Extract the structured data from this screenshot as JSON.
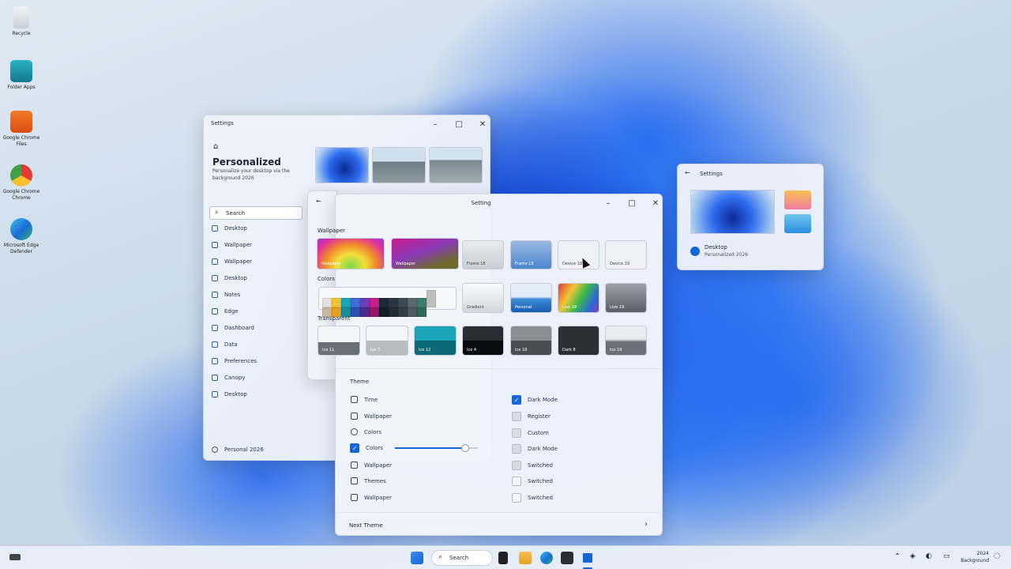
{
  "desktop": {
    "icons": [
      {
        "label": "Recycle"
      },
      {
        "label": "Folder Apps"
      },
      {
        "label": "Google Chrome Files"
      },
      {
        "label": "Google Chrome Chrome"
      },
      {
        "label": "Microsoft Edge Defender"
      }
    ]
  },
  "personalize_window": {
    "title": "Settings",
    "heading": "Personalized",
    "subtext_line1": "Personalize your desktop via the",
    "subtext_line2": "background 2026",
    "search_label": "Search",
    "nav": [
      "Desktop",
      "Wallpaper",
      "Wallpaper",
      "Desktop",
      "Notes",
      "Edge",
      "Dashboard",
      "Data",
      "Preferences",
      "Canopy",
      "Desktop"
    ],
    "footer": "Personal 2026"
  },
  "settings_window": {
    "title": "Setting",
    "section_wallpaper": "Wallpaper",
    "wallpaper_thumbs": [
      "Wallpaper",
      "Wallpaper",
      "Frame 18",
      "Frame 18",
      "Device 19",
      "Device 19"
    ],
    "section_colors": "Colors",
    "color_thumbs": [
      "Gradient",
      "Personal",
      "Live 18",
      "Live 19"
    ],
    "section_transparent": "Transparent",
    "trans_thumbs": [
      "Ice 11",
      "Ice 3",
      "Ice 12",
      "Ice 4",
      "Ice 18",
      "Dark 8",
      "Ice 19"
    ],
    "theme_label": "Theme",
    "theme_left": [
      "Time",
      "Wallpaper",
      "Colors",
      "Colors",
      "Wallpaper",
      "Themes",
      "Wallpaper"
    ],
    "theme_right": [
      "Dark Mode",
      "Register",
      "Custom",
      "Dark Mode",
      "Switched",
      "Switched",
      "Switched"
    ],
    "slider_value": 0.85,
    "next_theme": "Next Theme"
  },
  "small_window": {
    "title": "Settings",
    "item_title": "Desktop",
    "item_sub": "Personalized 2026"
  },
  "taskbar": {
    "search": "Search",
    "time": "2024",
    "date": "Background"
  },
  "colors": {
    "accent": "#1466d6",
    "swatches": [
      "#e2e2e2",
      "#f2c434",
      "#1aa6b8",
      "#3c6ed8",
      "#6a3fb8",
      "#c81e8c",
      "#1c2a38",
      "#2b3642",
      "#3d4a54",
      "#5c6770",
      "#3d7d6e",
      "#bfbfbf"
    ]
  }
}
